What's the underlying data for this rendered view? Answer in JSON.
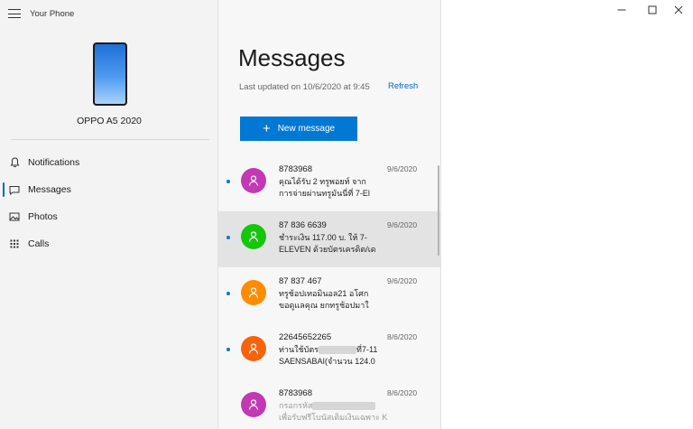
{
  "app": {
    "title": "Your Phone"
  },
  "phone": {
    "name": "OPPO A5 2020"
  },
  "nav": {
    "items": [
      {
        "label": "Notifications",
        "icon": "bell-icon",
        "active": false
      },
      {
        "label": "Messages",
        "icon": "chat-icon",
        "active": true
      },
      {
        "label": "Photos",
        "icon": "photos-icon",
        "active": false
      },
      {
        "label": "Calls",
        "icon": "dialpad-icon",
        "active": false
      }
    ]
  },
  "messages": {
    "heading": "Messages",
    "last_updated": "Last updated on 10/6/2020 at 9:45",
    "refresh_label": "Refresh",
    "new_message_label": "New message",
    "list": [
      {
        "sender": "8783968",
        "date": "9/6/2020",
        "line1": "คุณได้รับ 2 ทรูพอยท์ จาก",
        "line2": "การจ่ายผ่านทรูมันนี่ที่ 7-El",
        "unread": true,
        "color": "#c239b3",
        "selected": false
      },
      {
        "sender": "87 836 6639",
        "date": "9/6/2020",
        "line1": "ชำระเงิน 117.00 บ. ให้ 7-",
        "line2": "ELEVEN ด้วยบัตรเครดิต/เด",
        "unread": true,
        "color": "#16c60c",
        "selected": true
      },
      {
        "sender": "87 837 467",
        "date": "9/6/2020",
        "line1": "ทรูช้อปเทอมินอล21 อโศก",
        "line2": "ขอดูแลคุณ ยกทรูช้อปมาใ",
        "unread": true,
        "color": "#ff8c00",
        "selected": false
      },
      {
        "sender": "22645652265",
        "date": "8/6/2020",
        "line1": "ท่านใช้บัตร",
        "line1b": "ที่7-11",
        "line2": "SAENSABAI(จำนวน 124.0",
        "unread": true,
        "color": "#f7630c",
        "selected": false
      },
      {
        "sender": "8783968",
        "date": "8/6/2020",
        "line1": "กรอกรหัส",
        "line2": "เพื่อรับฟรีโบนัสเติมเงินเฉพาะ K",
        "unread": false,
        "color": "#c239b3",
        "selected": false
      }
    ]
  },
  "window": {
    "controls": [
      "minimize-icon",
      "maximize-icon",
      "close-icon"
    ]
  }
}
